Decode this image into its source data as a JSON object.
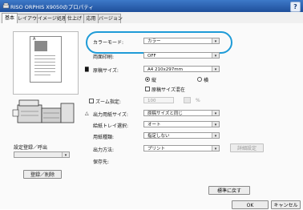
{
  "window": {
    "title": "RISO ORPHIS X9050のプロパティ",
    "help_label": "?"
  },
  "tabs": [
    "基本",
    "レイアウト",
    "イメージ処理",
    "仕上げ",
    "応用",
    "バージョン"
  ],
  "fields": {
    "color_mode_label": "カラーモード:",
    "color_mode_value": "カラー",
    "duplex_label": "両面印刷:",
    "duplex_value": "OFF",
    "paper_size_label": "原稿サイズ:",
    "paper_size_value": "A4 210x297mm",
    "orientation_portrait": "縦",
    "orientation_landscape": "横",
    "mixed_size_label": "原稿サイズ混在",
    "zoom_label": "ズーム指定:",
    "zoom_value": "100",
    "zoom_unit": "%",
    "output_size_label": "出力用紙サイズ:",
    "output_size_value": "原稿サイズと同じ",
    "tray_label": "給紙トレイ選択:",
    "tray_value": "オート",
    "paper_type_label": "用紙種類:",
    "paper_type_value": "指定しない",
    "output_method_label": "出力方法:",
    "output_method_value": "プリント",
    "detail_button": "詳細設定",
    "storage_label": "保存先:"
  },
  "left": {
    "register_label": "設定登録／呼出",
    "register_button": "登録／削除"
  },
  "buttons": {
    "standard": "標準に戻す",
    "ok": "OK",
    "cancel": "キャンセル"
  },
  "colors": {
    "titlebar": "#2b5fb0",
    "highlight": "#1e9bd7"
  }
}
